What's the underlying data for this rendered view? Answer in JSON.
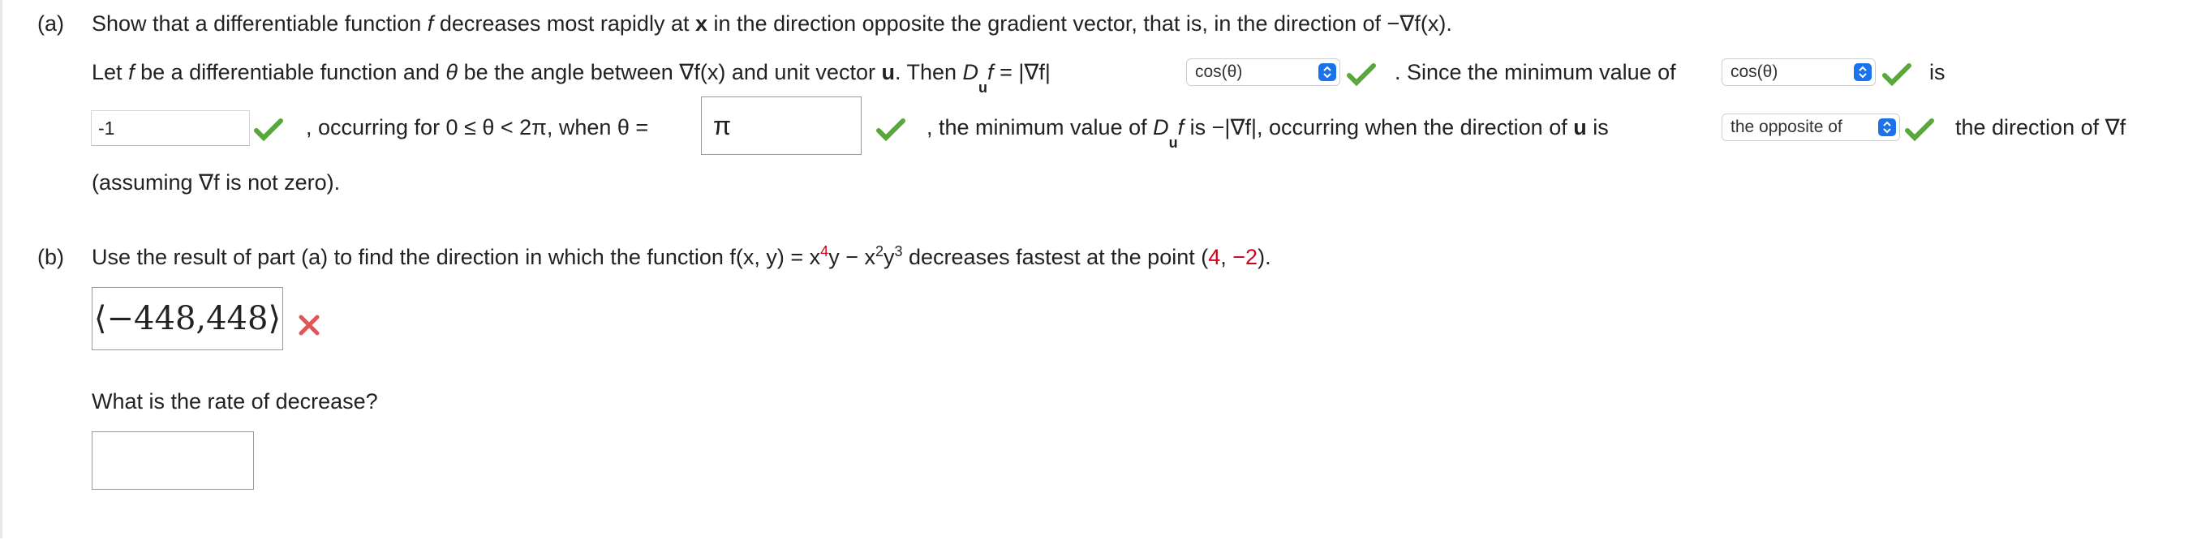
{
  "part_a": {
    "label": "(a)",
    "prompt_prefix": "Show that a differentiable function",
    "prompt_f": "f",
    "prompt_mid": "decreases most rapidly at",
    "prompt_x": "x",
    "prompt_suffix": "in the direction opposite the gradient vector, that is, in the direction of −∇f(x).",
    "line1_let": "Let",
    "line1_f": "f",
    "line1_be": "be a differentiable function and",
    "line1_theta": "θ",
    "line1_angle": "be the angle between ∇f(x) and unit vector",
    "line1_u": "u",
    "line1_then": ". Then",
    "line1_D": "D",
    "line1_Dsub": "u",
    "line1_f2": "f",
    "line1_eq": "= |∇f|",
    "select1_value": "cos(θ)",
    "line1_since": ". Since the minimum value of",
    "select2_value": "cos(θ)",
    "line1_is": "is",
    "field_min_value": "-1",
    "line2_occurring": ", occurring for 0 ≤ θ < 2π, when θ =",
    "field_theta_value": "π",
    "line2_min": ", the minimum value of",
    "line2_D": "D",
    "line2_Dsub": "u",
    "line2_f": "f",
    "line2_is": "is −|∇f|, occurring when the direction of",
    "line2_u": "u",
    "line2_is2": "is",
    "select3_value": "the opposite of",
    "line2_dir": "the direction of ∇f",
    "line3": "(assuming ∇f is not zero)."
  },
  "part_b": {
    "label": "(b)",
    "prompt_prefix": "Use the result of part (a) to find the direction in which the function f(x, y) = x",
    "exp4": "4",
    "y1": "y − x",
    "exp2": "2",
    "y2": "y",
    "exp3": "3",
    "prompt_suffix": "decreases fastest at the point (",
    "point_x": "4",
    "comma": ", ",
    "point_y": "−2",
    "close": ").",
    "answer_direction": "⟨−448,448⟩",
    "rate_question": "What is the rate of decrease?",
    "rate_value": ""
  },
  "colors": {
    "correct": "#5aa83c",
    "incorrect": "#e05555",
    "accent": "#1a73e8",
    "highlight_red": "#d0021b"
  }
}
